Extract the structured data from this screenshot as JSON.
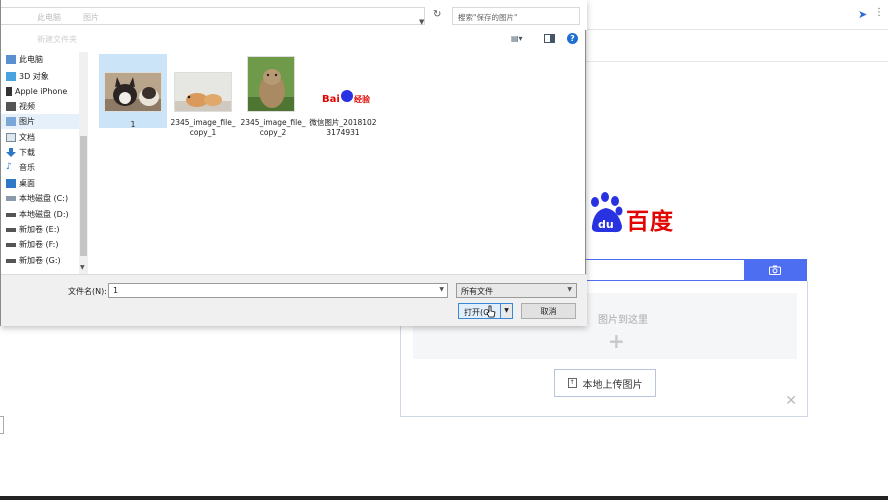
{
  "dialog": {
    "address": {
      "crumbs": [
        "此电脑",
        "图片"
      ],
      "search_placeholder": "搜索\"保存的图片\""
    },
    "toolbar": {
      "blurred_label": "新建文件夹"
    },
    "nav": {
      "items": [
        {
          "label": "此电脑",
          "icon": "computer-icon"
        },
        {
          "label": "3D 对象",
          "icon": "3d-objects-icon"
        },
        {
          "label": "Apple iPhone",
          "icon": "phone-icon"
        },
        {
          "label": "视频",
          "icon": "video-icon"
        },
        {
          "label": "图片",
          "icon": "pictures-icon",
          "selected": true
        },
        {
          "label": "文档",
          "icon": "documents-icon"
        },
        {
          "label": "下载",
          "icon": "download-icon"
        },
        {
          "label": "音乐",
          "icon": "music-icon"
        },
        {
          "label": "桌面",
          "icon": "desktop-icon"
        },
        {
          "label": "本地磁盘 (C:)",
          "icon": "drive-icon"
        },
        {
          "label": "本地磁盘 (D:)",
          "icon": "drive-icon"
        },
        {
          "label": "新加卷 (E:)",
          "icon": "drive-icon"
        },
        {
          "label": "新加卷 (F:)",
          "icon": "drive-icon"
        },
        {
          "label": "新加卷 (G:)",
          "icon": "drive-icon"
        }
      ]
    },
    "files": [
      {
        "name": "1",
        "selected": true
      },
      {
        "name": "2345_image_file_copy_1"
      },
      {
        "name": "2345_image_file_copy_2"
      },
      {
        "name": "微信图片_20181023174931"
      }
    ],
    "filename": {
      "label": "文件名(N):",
      "value": "1"
    },
    "filetype": {
      "value": "所有文件"
    },
    "buttons": {
      "open": "打开(O)",
      "cancel": "取消"
    }
  },
  "baidu": {
    "logo_text": "百度",
    "drop_hint": "图片到这里",
    "local_upload": "本地上传图片",
    "badge_text": "Bai 经验"
  },
  "colors": {
    "accent": "#4e6ef2",
    "brand_red": "#e10601",
    "brand_blue": "#2932e1"
  }
}
